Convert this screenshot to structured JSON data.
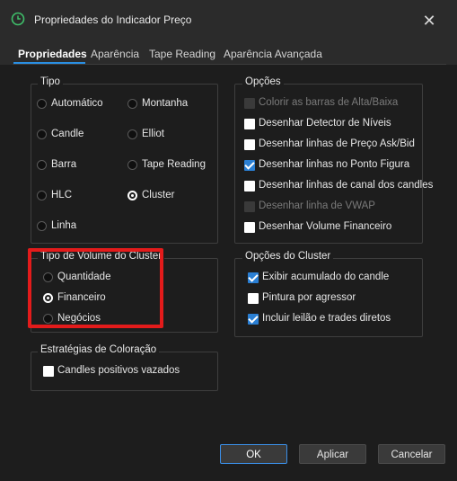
{
  "window": {
    "title": "Propriedades do Indicador Preço",
    "close_symbol": "✕"
  },
  "tabs": [
    {
      "label": "Propriedades",
      "active": true
    },
    {
      "label": "Aparência",
      "active": false
    },
    {
      "label": "Tape Reading",
      "active": false
    },
    {
      "label": "Aparência Avançada",
      "active": false
    }
  ],
  "tipo": {
    "legend": "Tipo",
    "options": [
      {
        "label": "Automático",
        "selected": false
      },
      {
        "label": "Montanha",
        "selected": false
      },
      {
        "label": "Candle",
        "selected": false
      },
      {
        "label": "Elliot",
        "selected": false
      },
      {
        "label": "Barra",
        "selected": false
      },
      {
        "label": "Tape Reading",
        "selected": false
      },
      {
        "label": "HLC",
        "selected": false
      },
      {
        "label": "Cluster",
        "selected": true
      },
      {
        "label": "Linha",
        "selected": false
      }
    ]
  },
  "opcoes": {
    "legend": "Opções",
    "items": [
      {
        "label": "Colorir as barras de Alta/Baixa",
        "checked": false,
        "disabled": true
      },
      {
        "label": "Desenhar Detector de Níveis",
        "checked": false,
        "disabled": false
      },
      {
        "label": "Desenhar linhas de Preço Ask/Bid",
        "checked": false,
        "disabled": false
      },
      {
        "label": "Desenhar linhas no Ponto Figura",
        "checked": true,
        "disabled": false
      },
      {
        "label": "Desenhar linhas de canal dos candles",
        "checked": false,
        "disabled": false
      },
      {
        "label": "Desenhar linha de VWAP",
        "checked": false,
        "disabled": true
      },
      {
        "label": "Desenhar Volume Financeiro",
        "checked": false,
        "disabled": false
      }
    ]
  },
  "volume_cluster": {
    "legend": "Tipo de Volume do Cluster",
    "options": [
      {
        "label": "Quantidade",
        "selected": false
      },
      {
        "label": "Financeiro",
        "selected": true
      },
      {
        "label": "Negócios",
        "selected": false
      }
    ]
  },
  "opcoes_cluster": {
    "legend": "Opções do Cluster",
    "items": [
      {
        "label": "Exibir acumulado do candle",
        "checked": true
      },
      {
        "label": "Pintura por agressor",
        "checked": false
      },
      {
        "label": "Incluir leilão e trades diretos",
        "checked": true
      }
    ]
  },
  "estrategias": {
    "legend": "Estratégias de Coloração",
    "items": [
      {
        "label": "Candles positivos vazados",
        "checked": false
      }
    ]
  },
  "buttons": {
    "ok": "OK",
    "apply": "Aplicar",
    "cancel": "Cancelar"
  },
  "colors": {
    "accent": "#2a8fe3",
    "highlight": "#e31b1b",
    "background": "#1d1d1d",
    "titlebar": "#2b2b2b"
  }
}
